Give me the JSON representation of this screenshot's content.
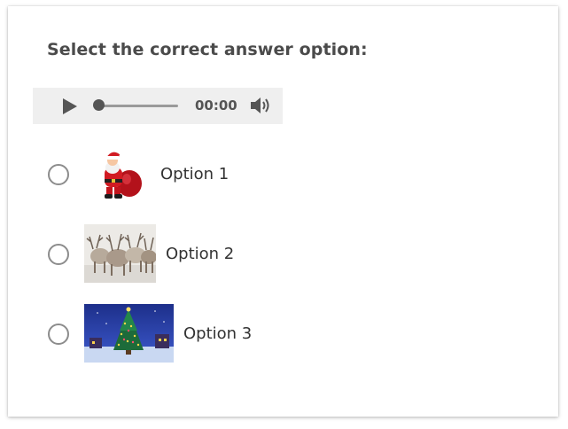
{
  "question": {
    "text": "Select the correct answer option:"
  },
  "audio": {
    "time": "00:00",
    "progress": 0
  },
  "options": [
    {
      "label": "Option 1",
      "image": "santa-claus"
    },
    {
      "label": "Option 2",
      "image": "reindeer-herd"
    },
    {
      "label": "Option 3",
      "image": "christmas-tree-night"
    }
  ]
}
